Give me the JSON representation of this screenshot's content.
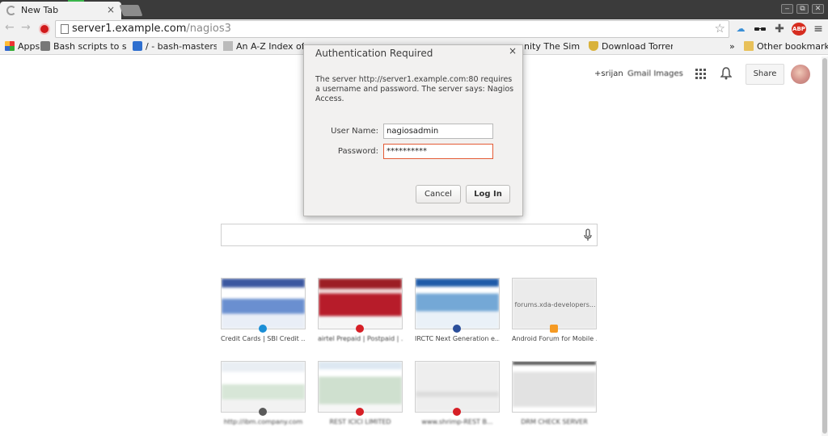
{
  "browser": {
    "tab_title": "New Tab",
    "tab_close": "×",
    "url_host": "server1.example.com",
    "url_path": "/nagios3",
    "window_controls": [
      "‒",
      "⧉",
      "✕"
    ],
    "extensions": [
      {
        "icon": "cloud-extension-icon",
        "color": "#3a8fd6",
        "text": "☁"
      },
      {
        "icon": "spy-extension-icon",
        "color": "#222222",
        "text": "👓"
      },
      {
        "icon": "puzzle-extension-icon",
        "color": "#555555",
        "text": "✚"
      },
      {
        "icon": "adblock-plus-icon",
        "color": "#d62d20",
        "text": "ABP"
      },
      {
        "icon": "menu-icon",
        "color": "#444444",
        "text": "≡"
      }
    ]
  },
  "bookmarks": {
    "items": [
      {
        "label": "Apps",
        "icon": "apps-grid-icon"
      },
      {
        "label": "Bash scripts to sca",
        "icon": "puzzle-bookmark-icon"
      },
      {
        "label": "/ - bash-masters - g",
        "icon": "house-bookmark-icon"
      },
      {
        "label": "An A-Z Index of th",
        "icon": "page-bookmark-icon"
      },
      {
        "label": "nity The Simple",
        "icon": "page-bookmark-icon"
      },
      {
        "label": "Download Torrent",
        "icon": "shield-bookmark-icon"
      }
    ],
    "overflow": "»",
    "other": "Other bookmarks"
  },
  "google_bar": {
    "user": "+srijan",
    "links": "Gmail  Images",
    "share": "Share"
  },
  "tiles": [
    {
      "label": "Credit Cards | SBI Credit ...",
      "fav_color": "#1b8ed6",
      "bg": "linear-gradient(180deg,#3b57a0 0 18%,#ffffff 18% 40%,#6a8fd0 40% 70%,#e9eef7 70%)"
    },
    {
      "label": "airtel Prepaid | Postpaid | ...",
      "fav_color": "#d61f26",
      "bg": "linear-gradient(180deg,#9c1d24 0 20%,#f0d8d8 20% 30%,#b71c2a 30% 75%,#f5f5f5 75%)"
    },
    {
      "label": "IRCTC Next Generation e...",
      "fav_color": "#2a4e9a",
      "bg": "linear-gradient(180deg,#1e5aa8 0 16%,#ffffff 16% 30%,#74a8d6 30% 65%,#eaf1f8 65%)"
    },
    {
      "label": "Android Forum for Mobile ...",
      "fav_color": "#f59a23",
      "bg": "#ebebeb",
      "caption": "forums.xda-developers..."
    },
    {
      "label": "http://ibm.company.com",
      "fav_color": "#5a5a5a",
      "bg": "linear-gradient(180deg,#e9eef3 0 20%,#ffffff 20% 45%,#d7e6d7 45% 75%,#f2f2f2 75%)"
    },
    {
      "label": "REST ICICI LIMITED",
      "fav_color": "#d61f26",
      "bg": "linear-gradient(180deg,#dde8f2 0 15%,#ffffff 15% 30%,#cfe0cf 30% 85%,#f6f6f6 85%)"
    },
    {
      "label": "www.shrimp-REST B...",
      "fav_color": "#d61f26",
      "bg": "linear-gradient(180deg,#eeeeee 0 60%,#dcdcdc 60% 70%,#eeeeee 70%)"
    },
    {
      "label": "DRM CHECK SERVER",
      "fav_color": "#2a2a2a",
      "bg": "linear-gradient(180deg,#2b2b2b 0 6%,#ffffff 6% 20%,#e2e2e2 20% 90%,#ffffff 90%)"
    }
  ],
  "dialog": {
    "title": "Authentication Required",
    "close": "×",
    "message": "The server http://server1.example.com:80 requires a username and password. The server says: Nagios Access.",
    "username_label": "User Name:",
    "username_value": "nagiosadmin",
    "password_label": "Password:",
    "password_value": "**********",
    "cancel_label": "Cancel",
    "login_label": "Log In",
    "focus_color": "#e45b35"
  }
}
